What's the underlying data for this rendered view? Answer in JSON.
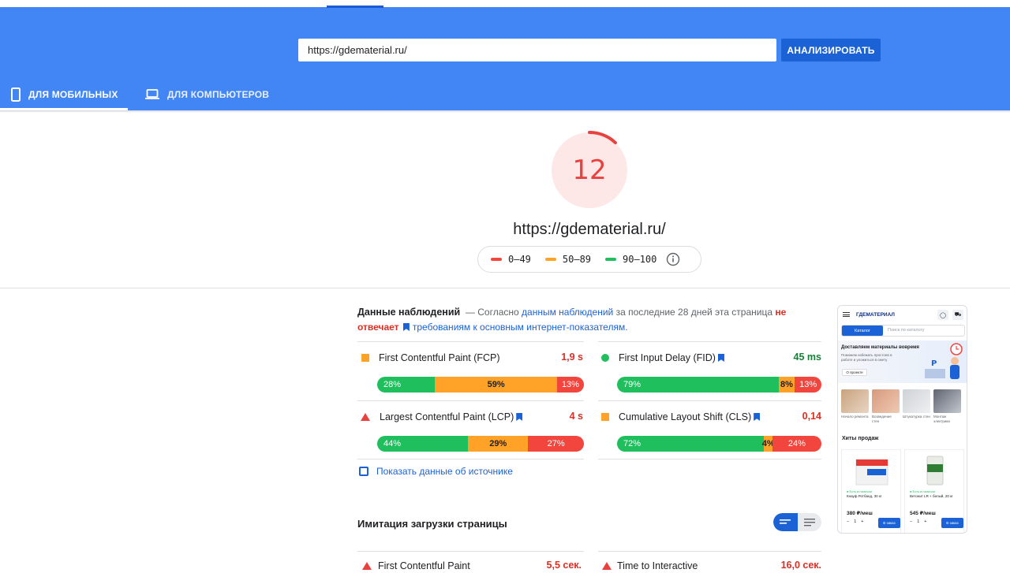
{
  "header": {
    "url_value": "https://gdematerial.ru/",
    "analyze_label": "АНАЛИЗИРОВАТЬ",
    "tabs": [
      {
        "label": "ДЛЯ МОБИЛЬНЫХ",
        "active": true
      },
      {
        "label": "ДЛЯ КОМПЬЮТЕРОВ",
        "active": false
      }
    ],
    "color": "#4285f4"
  },
  "score": {
    "value": "12",
    "percent": 12,
    "url": "https://gdematerial.ru/",
    "color": "#e8413e",
    "legend": [
      {
        "label": "0–49",
        "color": "#f2453d"
      },
      {
        "label": "50–89",
        "color": "#ffa227"
      },
      {
        "label": "90–100",
        "color": "#1fbf5e"
      }
    ]
  },
  "field": {
    "title": "Данные наблюдений",
    "t1": "— Согласно",
    "link1": "данным наблюдений",
    "t2": "за последние 28 дней эта страница",
    "fail1": "не",
    "fail2": "отвечает",
    "link2": "требованиям к основным интернет-показателям.",
    "metrics": [
      {
        "name": "First Contentful Paint (FCP)",
        "value": "1,9 s",
        "value_color": "#d93025",
        "good": "28%",
        "avg": "59%",
        "poor": "13%",
        "good_pct": 28,
        "avg_pct": 59,
        "poor_pct": 13
      },
      {
        "name": "First Input Delay (FID)",
        "value": "45 ms",
        "value_color": "#188038",
        "good": "79%",
        "avg": "8%",
        "poor": "13%",
        "good_pct": 79,
        "avg_pct": 8,
        "poor_pct": 13
      },
      {
        "name": "Largest Contentful Paint (LCP)",
        "value": "4 s",
        "value_color": "#d93025",
        "good": "44%",
        "avg": "29%",
        "poor": "27%",
        "good_pct": 44,
        "avg_pct": 29,
        "poor_pct": 27
      },
      {
        "name": "Cumulative Layout Shift (CLS)",
        "value": "0,14",
        "value_color": "#d93025",
        "good": "72%",
        "avg": "4%",
        "poor": "24%",
        "good_pct": 72,
        "avg_pct": 4,
        "poor_pct": 24
      }
    ],
    "show_source": "Показать данные об источнике"
  },
  "lab": {
    "title": "Имитация загрузки страницы",
    "metrics": [
      {
        "name": "First Contentful Paint",
        "value": "5,5 сек."
      },
      {
        "name": "Time to Interactive",
        "value": "16,0 сек."
      }
    ]
  },
  "preview": {
    "brand": "ГДЕМАТЕРИАЛ",
    "catalog": "Каталог",
    "search_placeholder": "Поиск по каталогу",
    "banner_title": "Доставляем материалы вовремя",
    "banner_text": "Поможем избежать простоев в работе и уложиться в смету",
    "banner_button": "О проекте",
    "tiles": [
      "Начало ремонта",
      "Возведение стен",
      "Штукатурка стен",
      "Монтаж электрики"
    ],
    "hits_title": "Хиты продаж",
    "products": [
      {
        "stock": "● Есть в наличии",
        "name": "Кнауф Ротбанд, 30 кг",
        "price": "380 ₽/меш",
        "buy": "В заказ"
      },
      {
        "stock": "● Есть в наличии",
        "name": "Ветонит LR + белый, 20 кг",
        "price": "545 ₽/меш",
        "buy": "В заказ"
      }
    ]
  }
}
